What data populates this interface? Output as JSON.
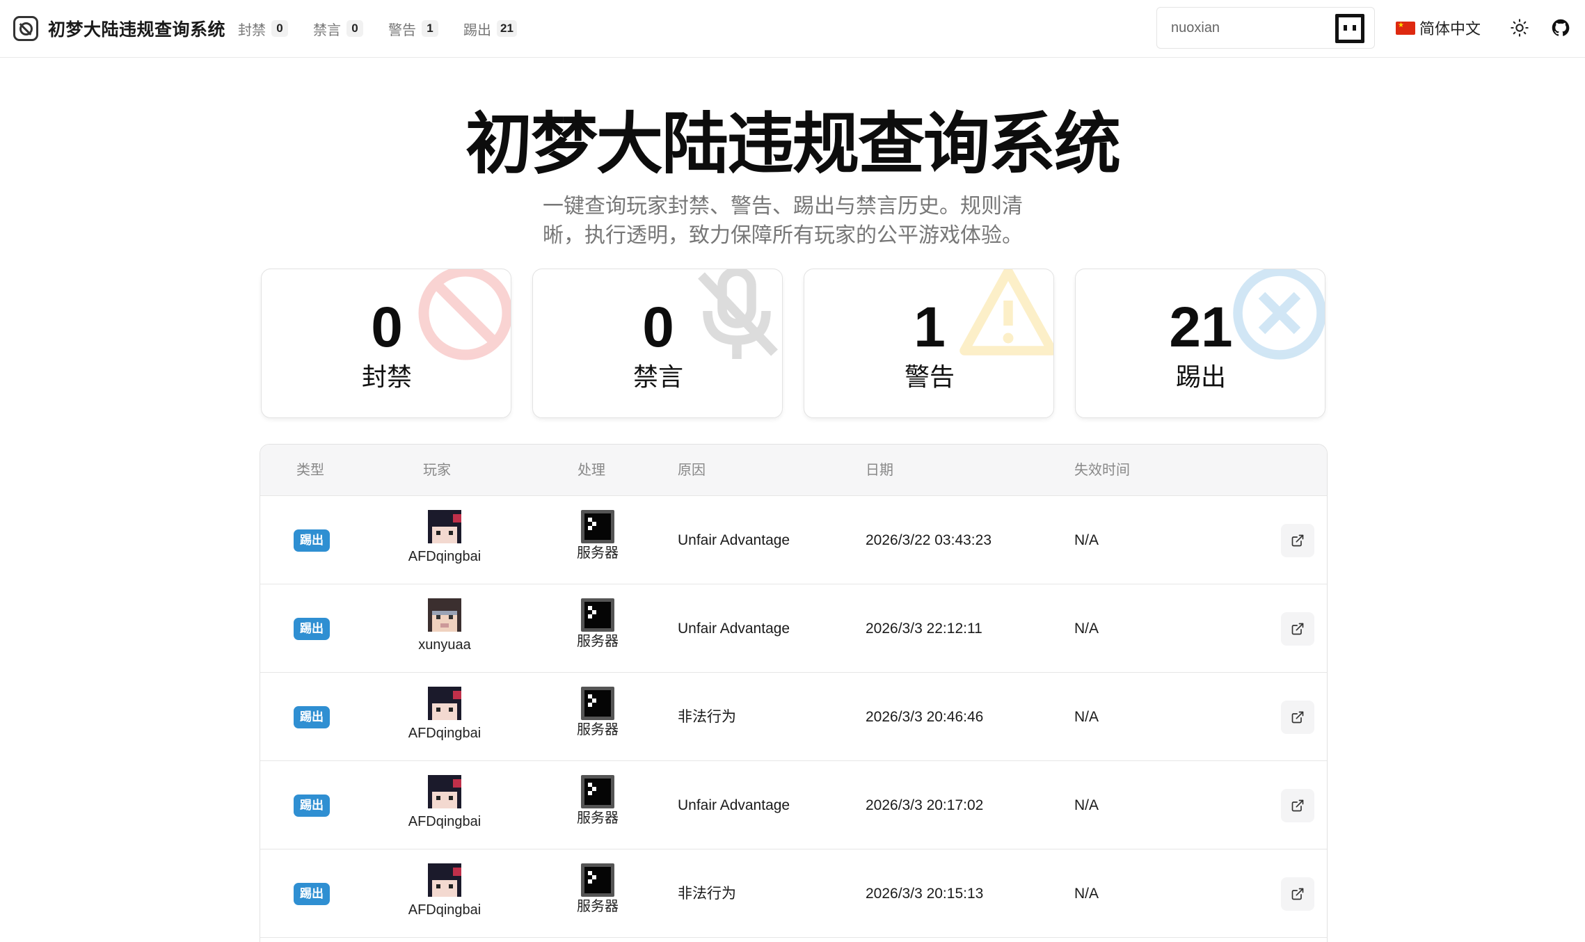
{
  "header": {
    "title": "初梦大陆违规查询系统",
    "nav": [
      {
        "label": "封禁",
        "count": "0"
      },
      {
        "label": "禁言",
        "count": "0"
      },
      {
        "label": "警告",
        "count": "1"
      },
      {
        "label": "踢出",
        "count": "21"
      }
    ],
    "search": {
      "value": "nuoxian"
    },
    "language": "简体中文"
  },
  "hero": {
    "title": "初梦大陆违规查询系统",
    "subtitle": "一键查询玩家封禁、警告、踢出与禁言历史。规则清晰，执行透明，致力保障所有玩家的公平游戏体验。"
  },
  "stats": [
    {
      "value": "0",
      "label": "封禁",
      "color": "#e53935"
    },
    {
      "value": "0",
      "label": "禁言",
      "color": "#616161"
    },
    {
      "value": "1",
      "label": "警告",
      "color": "#f2b705"
    },
    {
      "value": "21",
      "label": "踢出",
      "color": "#2f8fd2"
    }
  ],
  "table": {
    "headers": [
      "类型",
      "玩家",
      "处理",
      "原因",
      "日期",
      "失效时间"
    ],
    "rows": [
      {
        "type": "踢出",
        "player": "AFDqingbai",
        "handler": "服务器",
        "reason": "Unfair Advantage",
        "date": "2026/3/22 03:43:23",
        "expires": "N/A"
      },
      {
        "type": "踢出",
        "player": "xunyuaa",
        "handler": "服务器",
        "reason": "Unfair Advantage",
        "date": "2026/3/3 22:12:11",
        "expires": "N/A"
      },
      {
        "type": "踢出",
        "player": "AFDqingbai",
        "handler": "服务器",
        "reason": "非法行为",
        "date": "2026/3/3 20:46:46",
        "expires": "N/A"
      },
      {
        "type": "踢出",
        "player": "AFDqingbai",
        "handler": "服务器",
        "reason": "Unfair Advantage",
        "date": "2026/3/3 20:17:02",
        "expires": "N/A"
      },
      {
        "type": "踢出",
        "player": "AFDqingbai",
        "handler": "服务器",
        "reason": "非法行为",
        "date": "2026/3/3 20:15:13",
        "expires": "N/A"
      }
    ]
  },
  "colors": {
    "accent": "#2f8fd2",
    "border": "#e2e2e2",
    "muted": "#888888"
  }
}
